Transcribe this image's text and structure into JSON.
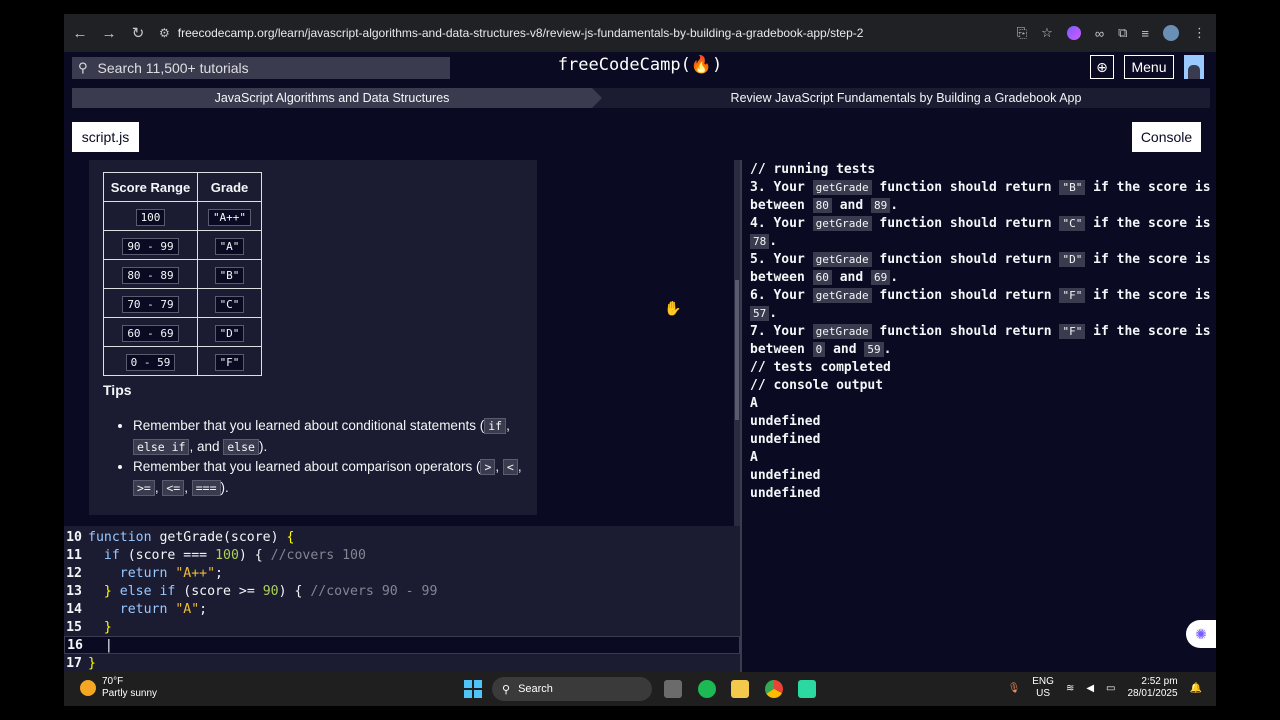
{
  "browser": {
    "url": "freecodecamp.org/learn/javascript-algorithms-and-data-structures-v8/review-js-fundamentals-by-building-a-gradebook-app/step-2"
  },
  "header": {
    "search_placeholder": "Search 11,500+ tutorials",
    "logo": "freeCodeCamp(🔥)",
    "menu_label": "Menu"
  },
  "breadcrumb": {
    "superblock": "JavaScript Algorithms and Data Structures",
    "block": "Review JavaScript Fundamentals by Building a Gradebook App"
  },
  "tabs": {
    "script": "script.js",
    "console": "Console"
  },
  "table": {
    "headers": [
      "Score Range",
      "Grade"
    ],
    "rows": [
      [
        "100",
        "\"A++\""
      ],
      [
        "90 - 99",
        "\"A\""
      ],
      [
        "80 - 89",
        "\"B\""
      ],
      [
        "70 - 79",
        "\"C\""
      ],
      [
        "60 - 69",
        "\"D\""
      ],
      [
        "0 - 59",
        "\"F\""
      ]
    ]
  },
  "tips": {
    "title": "Tips",
    "tip1": {
      "pre": "Remember that you learned about conditional statements (",
      "c1": "if",
      "sep1": ",",
      "c2": "else if",
      "mid": ", and ",
      "c3": "else",
      "post": ")."
    },
    "tip2": {
      "pre": "Remember that you learned about comparison operators (",
      "c1": ">",
      "sep1": ", ",
      "c2": "<",
      "sep2": ",",
      "c3": ">=",
      "sep3": ", ",
      "c4": "<=",
      "sep4": ", ",
      "c5": "===",
      "post": ")."
    }
  },
  "editor": {
    "lines": [
      {
        "n": "10"
      },
      {
        "n": "11"
      },
      {
        "n": "12"
      },
      {
        "n": "13"
      },
      {
        "n": "14"
      },
      {
        "n": "15"
      },
      {
        "n": "16"
      },
      {
        "n": "17"
      }
    ],
    "code": {
      "l10_kw": "function",
      "l10_fn": " getGrade(score) ",
      "l10_brace": "{",
      "l11_kw": "if",
      "l11_a": " (score === ",
      "l11_num": "100",
      "l11_b": ") { ",
      "l11_cm": "//covers 100",
      "l12_kw": "return",
      "l12_str": " \"A++\"",
      "l12_end": ";",
      "l13_a": "} ",
      "l13_kw": "else if",
      "l13_b": " (score >= ",
      "l13_num": "90",
      "l13_c": ") { ",
      "l13_cm": "//covers 90 - 99",
      "l14_kw": "return",
      "l14_str": " \"A\"",
      "l14_end": ";",
      "l15_brace": "}",
      "l17_brace": "}"
    }
  },
  "console": {
    "running": "// running tests",
    "t3a": "3. Your ",
    "t3c1": "getGrade",
    "t3b": " function should return ",
    "t3c2": "\"B\"",
    "t3c": " if the score is",
    "t3d": "between ",
    "t3c3": "80",
    "t3e": " and ",
    "t3c4": "89",
    "t3f": ".",
    "t4a": "4. Your ",
    "t4c1": "getGrade",
    "t4b": " function should return ",
    "t4c2": "\"C\"",
    "t4c": " if the score is",
    "t4c3": "78",
    "t4f": ".",
    "t5a": "5. Your ",
    "t5c1": "getGrade",
    "t5b": " function should return ",
    "t5c2": "\"D\"",
    "t5c": " if the score is",
    "t5d": "between ",
    "t5c3": "60",
    "t5e": " and ",
    "t5c4": "69",
    "t5f": ".",
    "t6a": "6. Your ",
    "t6c1": "getGrade",
    "t6b": " function should return ",
    "t6c2": "\"F\"",
    "t6c": " if the score is",
    "t6c3": "57",
    "t6f": ".",
    "t7a": "7. Your ",
    "t7c1": "getGrade",
    "t7b": " function should return ",
    "t7c2": "\"F\"",
    "t7c": " if the score is",
    "t7d": "between ",
    "t7c3": "0",
    "t7e": " and ",
    "t7c4": "59",
    "t7f": ".",
    "completed": "// tests completed",
    "output_label": "// console output",
    "outputs": [
      "A",
      "undefined",
      "undefined",
      "A",
      "undefined",
      "undefined"
    ]
  },
  "taskbar": {
    "temp": "70°F",
    "weather": "Partly sunny",
    "search": "Search",
    "lang1": "ENG",
    "lang2": "US",
    "time": "2:52 pm",
    "date": "28/01/2025"
  },
  "colors": {
    "bg": "#0a0a23",
    "panel": "#1b1b32",
    "keyword": "#99c9ff",
    "string": "#f1be32",
    "number": "#acd157",
    "comment": "#858591"
  }
}
